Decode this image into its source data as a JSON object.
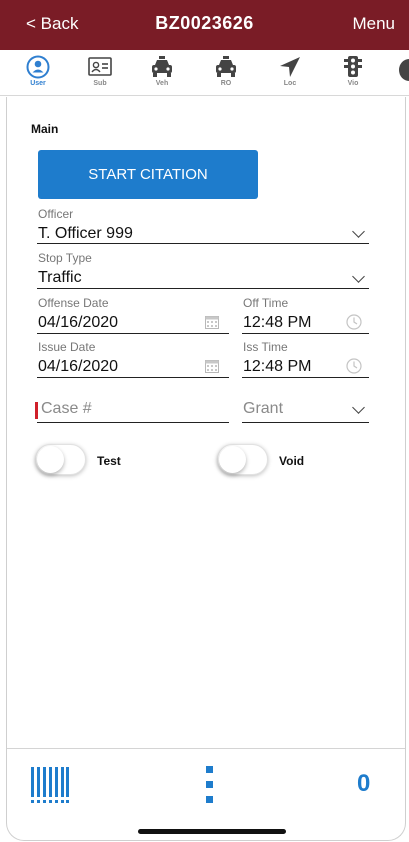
{
  "header": {
    "back_label": "< Back",
    "title": "BZ0023626",
    "menu_label": "Menu",
    "background_color": "#7a1c26"
  },
  "tabs": [
    {
      "label": "User",
      "icon": "user-circle-icon",
      "active": true
    },
    {
      "label": "Sub",
      "icon": "id-card-icon",
      "active": false
    },
    {
      "label": "Veh",
      "icon": "car-icon",
      "active": false
    },
    {
      "label": "RO",
      "icon": "car-icon",
      "active": false
    },
    {
      "label": "Loc",
      "icon": "location-arrow-icon",
      "active": false
    },
    {
      "label": "Vio",
      "icon": "traffic-light-icon",
      "active": false
    }
  ],
  "main": {
    "section_title": "Main",
    "start_citation_label": "START CITATION",
    "officer": {
      "label": "Officer",
      "value": "T. Officer 999"
    },
    "stop_type": {
      "label": "Stop Type",
      "value": "Traffic"
    },
    "offense_date": {
      "label": "Offense Date",
      "value": "04/16/2020"
    },
    "off_time": {
      "label": "Off Time",
      "value": "12:48 PM"
    },
    "issue_date": {
      "label": "Issue Date",
      "value": "04/16/2020"
    },
    "iss_time": {
      "label": "Iss Time",
      "value": "12:48 PM"
    },
    "case_number": {
      "placeholder": "Case #"
    },
    "grant": {
      "placeholder": "Grant"
    },
    "test_toggle": {
      "label": "Test",
      "on": false
    },
    "void_toggle": {
      "label": "Void",
      "on": false
    }
  },
  "bottom": {
    "count": "0",
    "accent_color": "#1e7ccc"
  }
}
